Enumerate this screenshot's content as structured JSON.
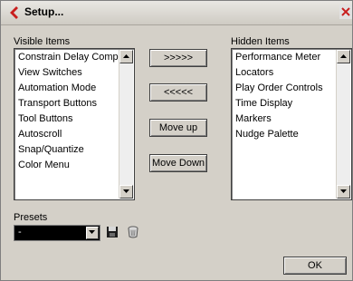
{
  "window": {
    "title": "Setup..."
  },
  "visible": {
    "label": "Visible Items",
    "items": [
      "Constrain Delay Compen",
      "View Switches",
      "Automation Mode",
      "Transport Buttons",
      "Tool Buttons",
      "Autoscroll",
      "Snap/Quantize",
      "Color Menu"
    ]
  },
  "hidden": {
    "label": "Hidden Items",
    "items": [
      "Performance Meter",
      "Locators",
      "Play Order Controls",
      "Time Display",
      "Markers",
      "Nudge Palette"
    ]
  },
  "buttons": {
    "move_right": ">>>>>",
    "move_left": "<<<<<",
    "move_up": "Move up",
    "move_down": "Move Down",
    "ok": "OK"
  },
  "presets": {
    "label": "Presets",
    "value": "-"
  },
  "icons": {
    "app": "cubase-logo-icon",
    "close": "close-icon",
    "save": "save-icon",
    "delete": "trash-icon"
  },
  "colors": {
    "accent": "#c81e1e",
    "window_bg": "#d4d0c8"
  }
}
